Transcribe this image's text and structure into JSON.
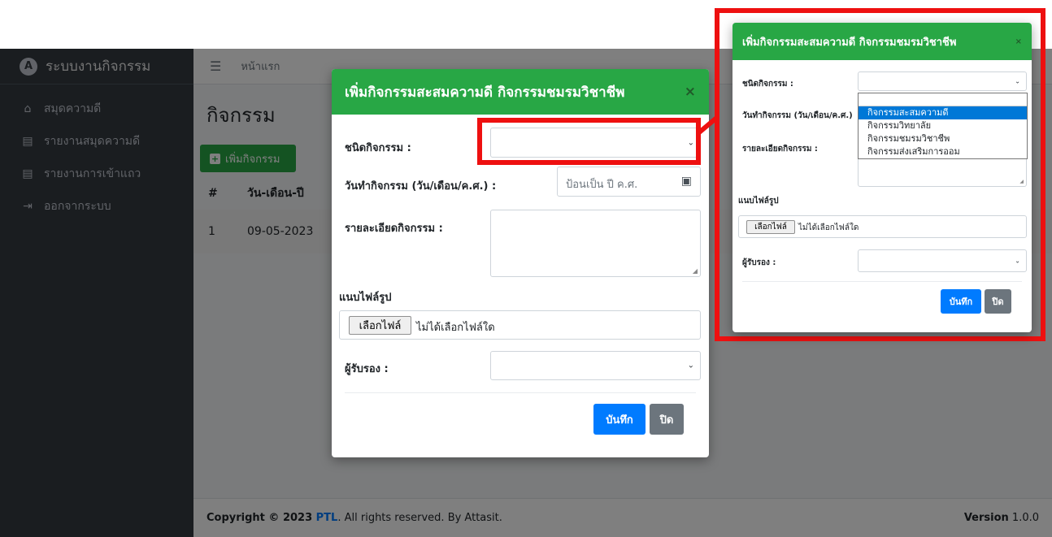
{
  "sidebar": {
    "brand": "ระบบงานกิจกรรม",
    "logo_letter": "A",
    "items": [
      {
        "label": "สมุดความดี",
        "icon": "home-icon"
      },
      {
        "label": "รายงานสมุดความดี",
        "icon": "print-icon"
      },
      {
        "label": "รายงานการเข้าแถว",
        "icon": "print-icon"
      },
      {
        "label": "ออกจากระบบ",
        "icon": "sign-out-icon"
      }
    ]
  },
  "topbar": {
    "home": "หน้าแรก"
  },
  "page": {
    "title": "กิจกรรม",
    "add_button": "เพิ่มกิจกรรม",
    "table": {
      "headers": [
        "#",
        "วัน-เดือน-ปี"
      ],
      "rows": [
        [
          "1",
          "09-05-2023"
        ]
      ]
    }
  },
  "footer": {
    "copyright_prefix": "Copyright © 2023 ",
    "brand": "PTL",
    "copyright_suffix": ". All rights reserved. By Attasit.",
    "version_label": "Version",
    "version": "1.0.0"
  },
  "modal": {
    "title": "เพิ่มกิจกรรมสะสมความดี กิจกรรมชมรมวิชาชีพ",
    "type_label": "ชนิดกิจกรรม :",
    "type_value": "",
    "date_label": "วันทำกิจกรรม (วัน/เดือน/ค.ศ.) :",
    "date_placeholder": "ป้อนเป็น ปี ค.ศ.",
    "detail_label": "รายละเอียดกิจกรรม :",
    "detail_value": "",
    "image_label": "แนบไฟล์รูป",
    "file_button": "เลือกไฟล์",
    "file_status": "ไม่ได้เลือกไฟล์ใด",
    "certifier_label": "ผู้รับรอง :",
    "certifier_value": "",
    "save_button": "บันทึก",
    "close_button": "ปิด"
  },
  "zoom": {
    "title": "เพิ่มกิจกรรมสะสมความดี กิจกรรมชมรมวิชาชีพ",
    "type_label": "ชนิดกิจกรรม :",
    "date_label": "วันทำกิจกรรม (วัน/เดือน/ค.ศ.)",
    "detail_label": "รายละเอียดกิจกรรม :",
    "image_label": "แนบไฟล์รูป",
    "file_button": "เลือกไฟล์",
    "file_status": "ไม่ได้เลือกไฟล์ใด",
    "certifier_label": "ผู้รับรอง :",
    "save_button": "บันทึก",
    "close_button": "ปิด",
    "dropdown_options": [
      "กิจกรรมสะสมความดี",
      "กิจกรรมวิทยาลัย",
      "กิจกรรมชมรมวิชาชีพ",
      "กิจกรรมส่งเสริมการออม"
    ],
    "dropdown_selected": "กิจกรรมสะสมความดี"
  },
  "colors": {
    "header_green": "#28a745",
    "highlight_red": "#ee1010",
    "save_blue": "#007bff"
  }
}
